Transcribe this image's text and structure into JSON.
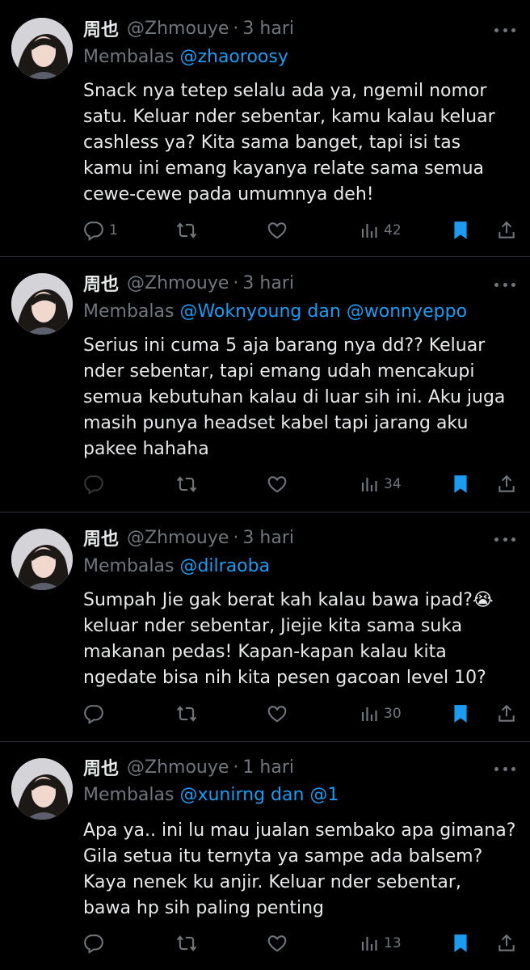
{
  "tweets": [
    {
      "name": "周也",
      "handle": "@Zhmouye",
      "time": "3 hari",
      "reply_prefix": "Membalas",
      "reply_to": "@zhaoroosy",
      "text": "Snack nya tetep selalu ada ya, ngemil nomor\nsatu. Keluar nder sebentar, kamu kalau keluar\ncashless ya? Kita sama banget, tapi isi tas\nkamu ini emang kayanya relate sama semua\ncewe-cewe pada umumnya deh!",
      "replies": "1",
      "views": "42",
      "reply_icon": "reply-icon",
      "retweet_icon": "retweet-icon",
      "like_icon": "heart-icon",
      "views_icon": "views-icon",
      "bookmark_icon": "bookmark-icon",
      "share_icon": "share-icon"
    },
    {
      "name": "周也",
      "handle": "@Zhmouye",
      "time": "3 hari",
      "reply_prefix": "Membalas",
      "reply_to": "@Woknyoung dan @wonnyeppo",
      "text": "Serius ini cuma 5 aja barang nya dd?? Keluar\nnder sebentar, tapi emang udah mencakupi\nsemua kebutuhan kalau di luar sih ini. Aku juga\nmasih punya headset kabel tapi jarang aku\npakee hahaha",
      "replies": "",
      "views": "34"
    },
    {
      "name": "周也",
      "handle": "@Zhmouye",
      "time": "3 hari",
      "reply_prefix": "Membalas",
      "reply_to": "@dilraoba",
      "text": "Sumpah Jie gak berat kah kalau bawa ipad?😭\nkeluar nder sebentar, Jiejie kita sama suka\nmakanan pedas! Kapan-kapan kalau kita\nngedate bisa nih kita pesen gacoan level 10?",
      "replies": "",
      "views": "30"
    },
    {
      "name": "周也",
      "handle": "@Zhmouye",
      "time": "1 hari",
      "reply_prefix": "Membalas",
      "reply_to": "@xunirng dan @1",
      "text": "Apa ya.. ini lu mau jualan sembako apa gimana?\nGila setua itu ternyta ya sampe ada balsem?\nKaya nenek ku anjir. Keluar nder sebentar,\nbawa hp sih paling penting",
      "replies": "",
      "views": "13"
    }
  ],
  "colors": {
    "background": "#000000",
    "text": "#e7e9ea",
    "muted": "#71767b",
    "accent": "#1d9bf0",
    "divider": "#2f3336"
  }
}
